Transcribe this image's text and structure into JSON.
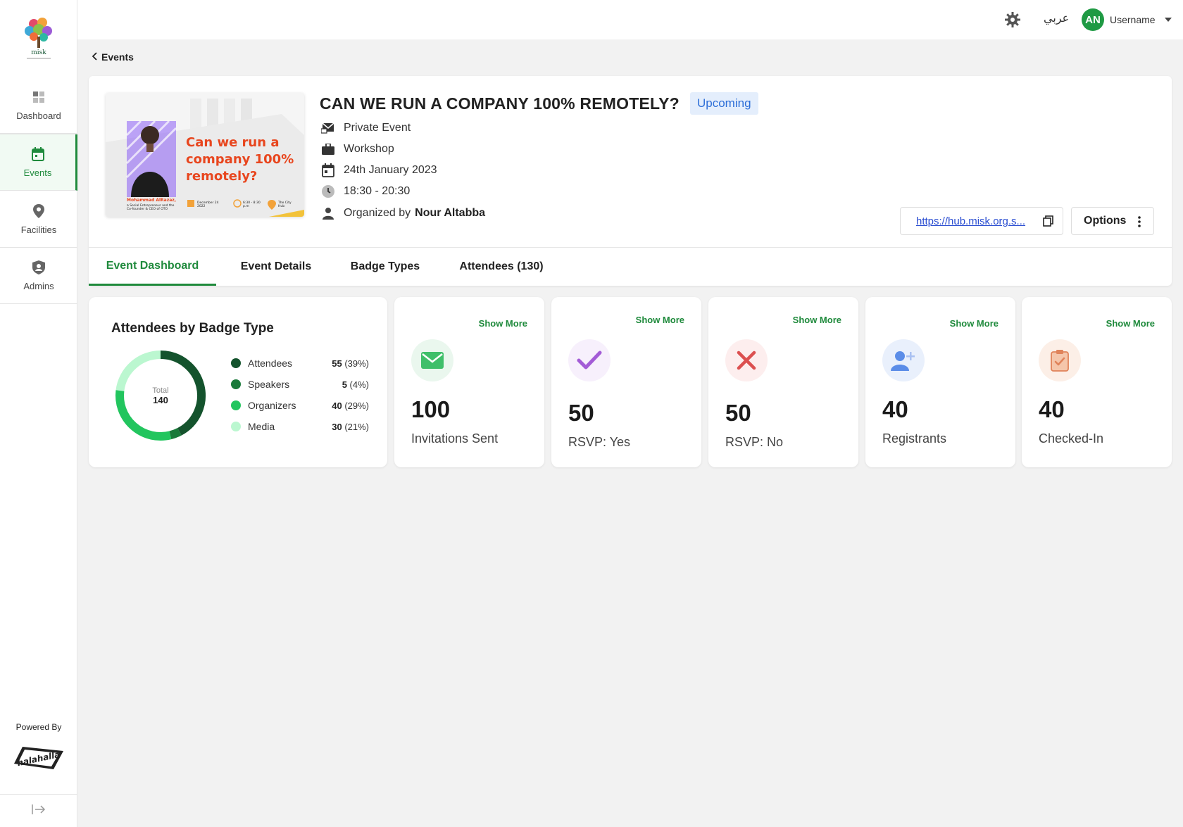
{
  "sidebar": {
    "logo_text": "misk",
    "items": [
      {
        "label": "Dashboard",
        "icon": "dashboard-grid-icon"
      },
      {
        "label": "Events",
        "icon": "calendar-icon"
      },
      {
        "label": "Facilities",
        "icon": "location-pin-icon"
      },
      {
        "label": "Admins",
        "icon": "admin-badge-icon"
      }
    ],
    "powered_by": "Powered By",
    "powered_logo": "halahalla-logo"
  },
  "topbar": {
    "language": "عربي",
    "avatar_initials": "AN",
    "username": "Username"
  },
  "breadcrumb": {
    "back_label": "Events"
  },
  "event": {
    "title": "CAN WE RUN A COMPANY 100% REMOTELY?",
    "status": "Upcoming",
    "privacy": "Private Event",
    "type": "Workshop",
    "date": "24th January 2023",
    "time": "18:30 - 20:30",
    "organized_prefix": "Organized by",
    "organizer": "Nour Altabba",
    "link": "https://hub.misk.org.s...",
    "options_label": "Options",
    "poster": {
      "headline_line1": "Can we run a",
      "headline_line2": "company 100%",
      "headline_line3": "remotely?",
      "speaker_name": "Mohammad AlRazaz,",
      "speaker_desc1": "a Social Entrepreneur and the",
      "speaker_desc2": "Co-founder & CEO of OTO",
      "date": "December 24",
      "date2": "2022",
      "time": "6:30 - 8:30",
      "time2": "p.m",
      "venue": "The City",
      "venue2": "Hub"
    }
  },
  "tabs": [
    {
      "label": "Event Dashboard",
      "active": true
    },
    {
      "label": "Event Details",
      "active": false
    },
    {
      "label": "Badge Types",
      "active": false
    },
    {
      "label": "Attendees (130)",
      "active": false
    }
  ],
  "badge_chart": {
    "title": "Attendees by Badge Type",
    "center_label": "Total",
    "center_value": "140",
    "legend": [
      {
        "name": "Attendees",
        "count": "55",
        "pct": "(39%)",
        "color": "#14532d"
      },
      {
        "name": "Speakers",
        "count": "5",
        "pct": "(4%)",
        "color": "#1a7a3a"
      },
      {
        "name": "Organizers",
        "count": "40",
        "pct": "(29%)",
        "color": "#22c55e"
      },
      {
        "name": "Media",
        "count": "30",
        "pct": "(21%)",
        "color": "#bbf7d0"
      }
    ]
  },
  "chart_data": {
    "type": "pie",
    "title": "Attendees by Badge Type",
    "categories": [
      "Attendees",
      "Speakers",
      "Organizers",
      "Media"
    ],
    "values": [
      55,
      5,
      40,
      30
    ],
    "colors": [
      "#14532d",
      "#1a7a3a",
      "#22c55e",
      "#bbf7d0"
    ],
    "total": 140
  },
  "stats": [
    {
      "show_more": "Show More",
      "value": "100",
      "label": "Invitations Sent",
      "icon": "envelope-icon",
      "accent": "#3fbf6a"
    },
    {
      "show_more": "Show More",
      "value": "50",
      "label": "RSVP: Yes",
      "icon": "checkmark-icon",
      "accent": "#a35bd6"
    },
    {
      "show_more": "Show More",
      "value": "50",
      "label": "RSVP: No",
      "icon": "x-icon",
      "accent": "#dc5050"
    },
    {
      "show_more": "Show More",
      "value": "40",
      "label": "Registrants",
      "icon": "add-user-icon",
      "accent": "#5b8de8"
    },
    {
      "show_more": "Show More",
      "value": "40",
      "label": "Checked-In",
      "icon": "clipboard-check-icon",
      "accent": "#e0835a"
    }
  ]
}
